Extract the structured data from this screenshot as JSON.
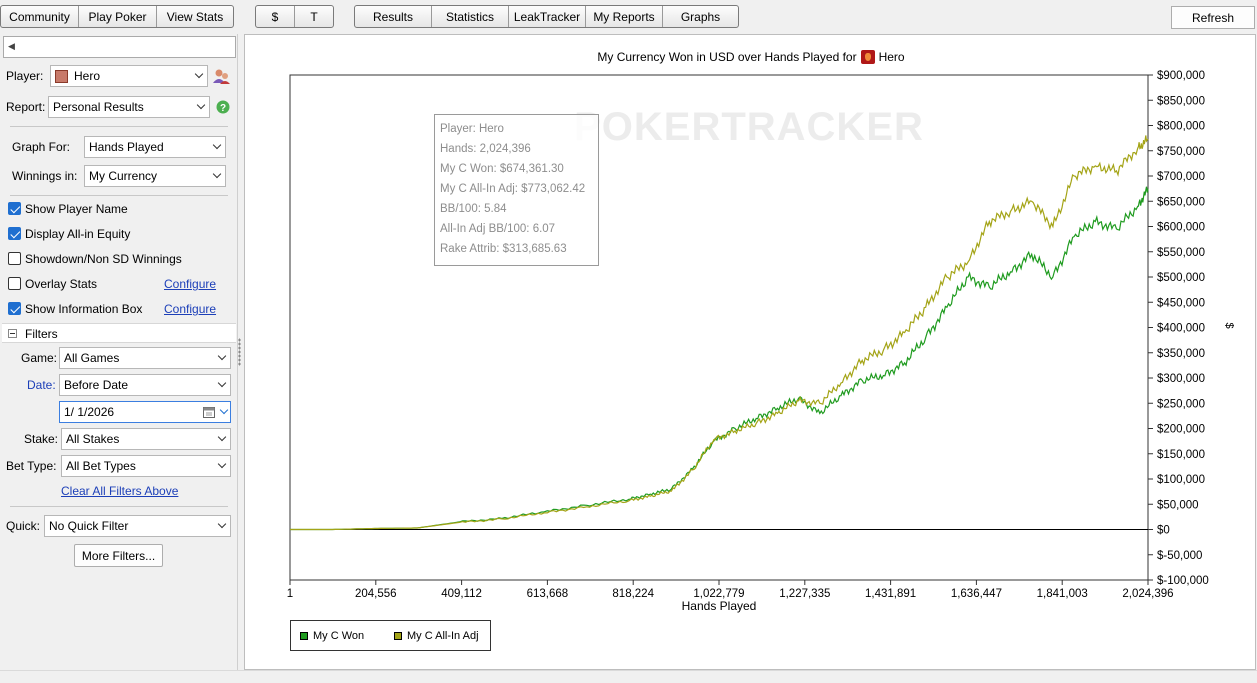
{
  "toolbar": {
    "group1": [
      "Community",
      "Play Poker",
      "View Stats"
    ],
    "group2": [
      "$",
      "T"
    ],
    "group3": [
      "Results",
      "Statistics",
      "LeakTracker",
      "My Reports",
      "Graphs"
    ],
    "refresh": "Refresh"
  },
  "left": {
    "player_label": "Player:",
    "player_value": "Hero",
    "report_label": "Report:",
    "report_value": "Personal Results",
    "graph_for_label": "Graph For:",
    "graph_for_value": "Hands Played",
    "winnings_label": "Winnings in:",
    "winnings_value": "My Currency",
    "checkboxes": [
      {
        "label": "Show Player Name",
        "checked": true
      },
      {
        "label": "Display All-in Equity",
        "checked": true
      },
      {
        "label": "Showdown/Non SD Winnings",
        "checked": false
      },
      {
        "label": "Overlay Stats",
        "checked": false
      },
      {
        "label": "Show Information Box",
        "checked": true
      }
    ],
    "configure": "Configure",
    "filters_title": "Filters",
    "game_label": "Game:",
    "game_value": "All Games",
    "date_label": "Date:",
    "date_value": "Before Date",
    "date_input": "1/  1/2026",
    "stake_label": "Stake:",
    "stake_value": "All Stakes",
    "bettype_label": "Bet Type:",
    "bettype_value": "All Bet Types",
    "clear_filters": "Clear All Filters Above",
    "quick_label": "Quick:",
    "quick_value": "No Quick Filter",
    "more_filters": "More Filters..."
  },
  "graph": {
    "title": "My Currency Won in USD over Hands Played for",
    "title_player": "Hero",
    "watermark": "POKERTRACKER",
    "y_unit": "$",
    "info_box": [
      "Player: Hero",
      "Hands: 2,024,396",
      "My C Won: $674,361.30",
      "My C All-In Adj: $773,062.42",
      "BB/100: 5.84",
      "All-In Adj BB/100: 6.07",
      "Rake Attrib: $313,685.63"
    ],
    "legend": [
      "My C Won",
      "My C All-In Adj"
    ]
  },
  "colors": {
    "won": "#1f9b1f",
    "allin": "#a4a417",
    "link": "#1c3fb8",
    "check": "#1f6fd0"
  },
  "chart_data": {
    "type": "line",
    "title": "My Currency Won in USD over Hands Played for Hero",
    "xlabel": "Hands Played",
    "ylabel": "$",
    "xlim": [
      1,
      2024396
    ],
    "ylim": [
      -100000,
      900000
    ],
    "x_ticks": [
      "1",
      "204,556",
      "409,112",
      "613,668",
      "818,224",
      "1,022,779",
      "1,227,335",
      "1,431,891",
      "1,636,447",
      "1,841,003",
      "2,024,396"
    ],
    "y_ticks": [
      "$900,000",
      "$850,000",
      "$800,000",
      "$750,000",
      "$700,000",
      "$650,000",
      "$600,000",
      "$550,000",
      "$500,000",
      "$450,000",
      "$400,000",
      "$350,000",
      "$300,000",
      "$250,000",
      "$200,000",
      "$150,000",
      "$100,000",
      "$50,000",
      "$0",
      "$-50,000",
      "$-100,000"
    ],
    "grid": false,
    "legend_position": "bottom-left",
    "series": [
      {
        "name": "My C Won",
        "x": [
          1,
          100000,
          200000,
          300000,
          400000,
          500000,
          600000,
          700000,
          800000,
          850000,
          900000,
          950000,
          1000000,
          1050000,
          1100000,
          1150000,
          1200000,
          1250000,
          1300000,
          1350000,
          1400000,
          1450000,
          1500000,
          1550000,
          1600000,
          1650000,
          1700000,
          1750000,
          1800000,
          1850000,
          1900000,
          1950000,
          2000000,
          2024396
        ],
        "y": [
          0,
          0,
          2000,
          3000,
          15000,
          22000,
          35000,
          48000,
          60000,
          70000,
          80000,
          120000,
          175000,
          200000,
          220000,
          240000,
          260000,
          230000,
          265000,
          295000,
          305000,
          330000,
          380000,
          440000,
          500000,
          480000,
          510000,
          545000,
          500000,
          580000,
          610000,
          595000,
          640000,
          674361
        ]
      },
      {
        "name": "My C All-In Adj",
        "x": [
          1,
          100000,
          200000,
          300000,
          400000,
          500000,
          600000,
          700000,
          800000,
          850000,
          900000,
          950000,
          1000000,
          1050000,
          1100000,
          1150000,
          1200000,
          1250000,
          1300000,
          1350000,
          1400000,
          1450000,
          1500000,
          1550000,
          1600000,
          1650000,
          1700000,
          1750000,
          1800000,
          1850000,
          1900000,
          1950000,
          2000000,
          2024396
        ],
        "y": [
          0,
          0,
          2000,
          3000,
          14000,
          21000,
          33000,
          45000,
          57000,
          66000,
          76000,
          118000,
          178000,
          195000,
          210000,
          230000,
          255000,
          250000,
          290000,
          335000,
          355000,
          390000,
          440000,
          500000,
          530000,
          610000,
          630000,
          650000,
          600000,
          700000,
          720000,
          710000,
          755000,
          773062
        ]
      }
    ]
  }
}
